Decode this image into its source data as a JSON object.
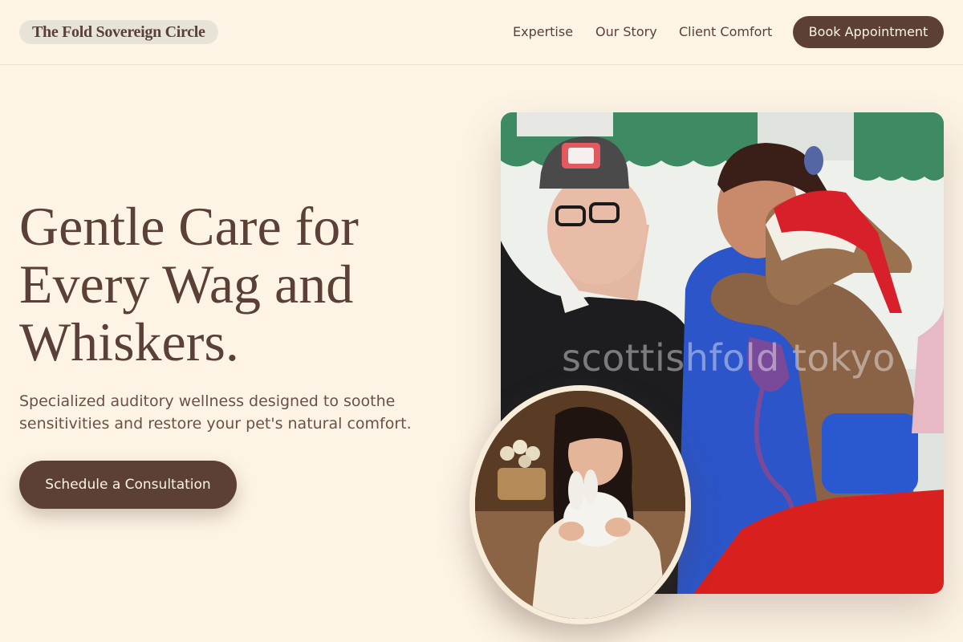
{
  "brand": {
    "name": "The Fold Sovereign Circle"
  },
  "nav": {
    "links": [
      "Expertise",
      "Our Story",
      "Client Comfort"
    ],
    "cta": "Book Appointment"
  },
  "hero": {
    "title_lines": [
      "Gentle Care for",
      "Every Wag and",
      "Whiskers."
    ],
    "subtitle_lines": [
      "Specialized auditory wellness designed to soothe",
      "sensitivities and restore your pet's natural comfort."
    ],
    "cta": "Schedule a Consultation"
  },
  "images": {
    "main_watermark": "scottishfold tokyo",
    "main_photo_subject": "alpaca-visit-photo",
    "inset_photo_subject": "woman-holding-bunny-photo"
  },
  "colors": {
    "background": "#fdf4e6",
    "primary": "#5c3f35",
    "logo_pill": "#e7e4d7",
    "text": "#5a4038"
  }
}
